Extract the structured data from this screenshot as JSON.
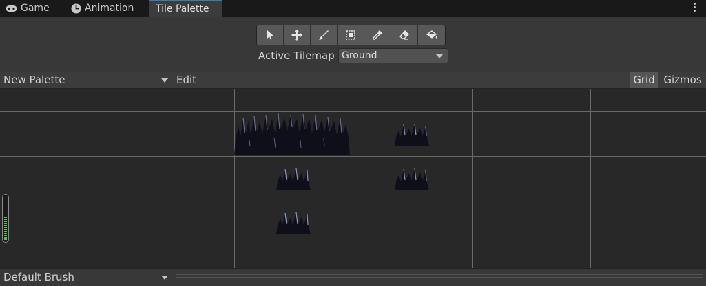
{
  "tabs": [
    {
      "label": "Game",
      "icon": "gamepad-icon",
      "active": false
    },
    {
      "label": "Animation",
      "icon": "clock-icon",
      "active": false
    },
    {
      "label": "Tile Palette",
      "icon": "",
      "active": true
    }
  ],
  "toolbar": {
    "tools": [
      "select-tool",
      "move-tool",
      "paint-brush-tool",
      "box-fill-tool",
      "picker-tool",
      "eraser-tool",
      "fill-bucket-tool"
    ]
  },
  "active_tilemap": {
    "label": "Active Tilemap",
    "value": "Ground"
  },
  "palette_bar": {
    "palette": "New Palette",
    "edit_label": "Edit",
    "grid_label": "Grid",
    "gizmos_label": "Gizmos",
    "grid_enabled": true
  },
  "palette_tiles": [
    {
      "name": "grass-tile-large",
      "column": 3,
      "row": 2
    },
    {
      "name": "grass-tile",
      "column": 4,
      "row": 2
    },
    {
      "name": "grass-tile",
      "column": 3,
      "row": 3
    },
    {
      "name": "grass-tile",
      "column": 4,
      "row": 3
    },
    {
      "name": "grass-tile",
      "column": 3,
      "row": 4
    }
  ],
  "zoom_level": 0.5,
  "brush_bar": {
    "brush": "Default Brush"
  },
  "colors": {
    "tab_accent": "#3a79bb",
    "zoom_indicator": "#4ec94e",
    "grass_dark": "#0f0f1a",
    "grass_highlight": "#8c93c8"
  }
}
